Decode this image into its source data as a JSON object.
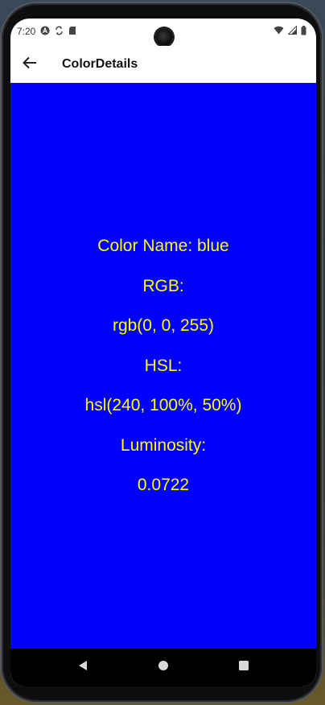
{
  "status_bar": {
    "time": "7:20",
    "icons_left": [
      "a-logo-icon",
      "sync-icon",
      "sd-card-icon"
    ],
    "icons_right": [
      "wifi-icon",
      "signal-icon",
      "battery-icon"
    ]
  },
  "app_bar": {
    "back_icon": "arrow-left-icon",
    "title": "ColorDetails"
  },
  "details": {
    "color_name": "Color Name: blue",
    "rgb_label": "RGB:",
    "rgb_value": "rgb(0, 0, 255)",
    "hsl_label": "HSL:",
    "hsl_value": "hsl(240, 100%, 50%)",
    "luminosity_label": "Luminosity:",
    "luminosity_value": "0.0722"
  },
  "colors": {
    "background": "#0000ff",
    "text": "#ffff00"
  },
  "nav_bar": {
    "items": [
      "back-triangle-icon",
      "home-circle-icon",
      "recents-square-icon"
    ]
  }
}
